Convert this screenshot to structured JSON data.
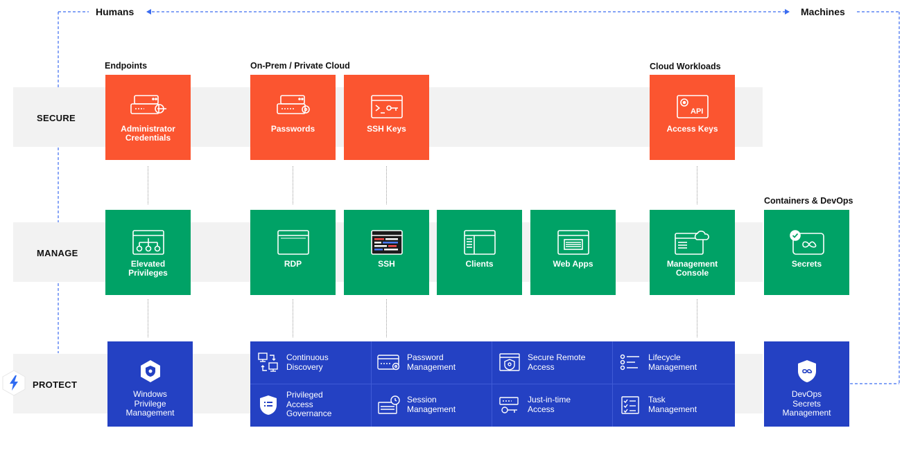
{
  "header": {
    "humans": "Humans",
    "machines": "Machines"
  },
  "rows": {
    "secure": "SECURE",
    "manage": "MANAGE",
    "protect": "PROTECT"
  },
  "groups": {
    "endpoints": "Endpoints",
    "onprem": "On-Prem / Private Cloud",
    "cloud": "Cloud Workloads",
    "containers": "Containers & DevOps"
  },
  "secure_tiles": [
    {
      "label": "Administrator\nCredentials",
      "icon": "server-key-icon"
    },
    {
      "label": "Passwords",
      "icon": "server-password-icon"
    },
    {
      "label": "SSH Keys",
      "icon": "terminal-key-icon"
    },
    {
      "label": "Access Keys",
      "icon": "api-window-icon"
    }
  ],
  "manage_tiles": [
    {
      "label": "Elevated\nPrivileges",
      "icon": "hierarchy-window-icon"
    },
    {
      "label": "RDP",
      "icon": "window-icon"
    },
    {
      "label": "SSH",
      "icon": "terminal-window-icon"
    },
    {
      "label": "Clients",
      "icon": "client-window-icon"
    },
    {
      "label": "Web Apps",
      "icon": "web-window-icon"
    },
    {
      "label": "Management\nConsole",
      "icon": "cloud-window-icon"
    },
    {
      "label": "Secrets",
      "icon": "secret-infinity-icon"
    }
  ],
  "protect": {
    "windows": "Windows\nPrivilege\nManagement",
    "devops": "DevOps\nSecrets\nManagement",
    "cells": [
      {
        "label": "Continuous\nDiscovery",
        "icon": "discovery-icon"
      },
      {
        "label": "Password\nManagement",
        "icon": "password-manage-icon"
      },
      {
        "label": "Secure Remote\nAccess",
        "icon": "shield-window-icon"
      },
      {
        "label": "Lifecycle\nManagement",
        "icon": "lifecycle-list-icon"
      },
      {
        "label": "Privileged\nAccess\nGovernance",
        "icon": "governance-shield-icon"
      },
      {
        "label": "Session\nManagement",
        "icon": "session-icon"
      },
      {
        "label": "Just-in-time\nAccess",
        "icon": "jit-key-icon"
      },
      {
        "label": "Task\nManagement",
        "icon": "task-list-icon"
      }
    ]
  },
  "colors": {
    "secure": "#fb5530",
    "manage": "#00a266",
    "protect": "#2441c3",
    "band": "#f2f2f2",
    "dash": "#3b6cf0"
  }
}
